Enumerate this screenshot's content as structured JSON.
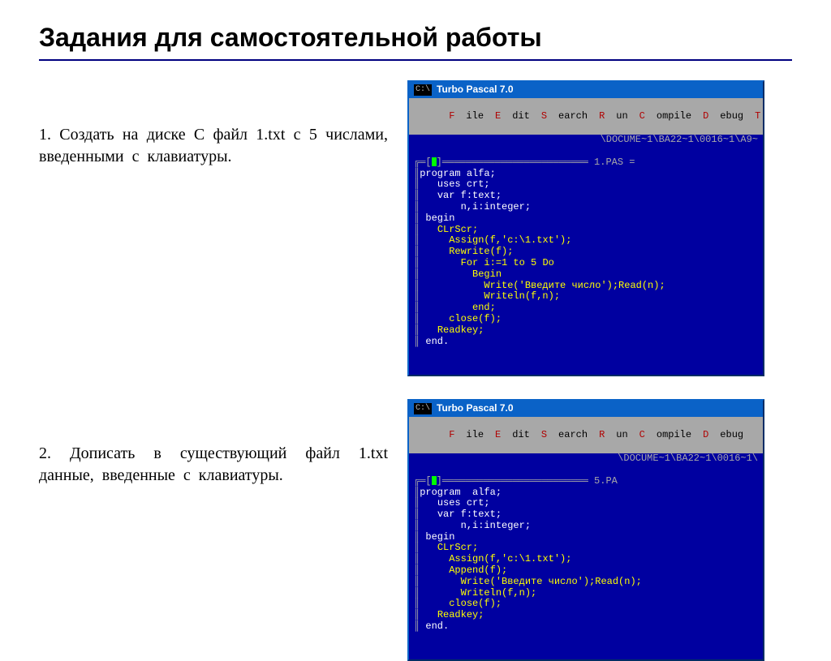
{
  "slide": {
    "title": "Задания для самостоятельной работы",
    "task1": "1. Создать на  диске  С  файл  1.txt  с  5 числами,  введенными с клавиатуры.",
    "task2": "2. Дописать  в  существующий  файл  1.txt данные,  введенные с клавиатуры."
  },
  "tp": {
    "appTitle": "Turbo Pascal 7.0",
    "sys": "C:\\",
    "menu": {
      "file": "File",
      "fileH": "F",
      "edit": "Edit",
      "editH": "E",
      "search": "Search",
      "searchH": "S",
      "run": "Run",
      "runH": "R",
      "compile": "Compile",
      "compileH": "C",
      "debug": "Debug",
      "debugH": "D",
      "trail": "T"
    }
  },
  "win1": {
    "path": "\\DOCUME~1\\BA22~1\\0016~1\\A9~",
    "file": "1.PAS =",
    "code": [
      {
        "pre": "",
        "t": "program alfa;",
        "cls": "wh"
      },
      {
        "pre": "   ",
        "t": "uses crt;",
        "cls": "wh"
      },
      {
        "pre": "   ",
        "t": "var f:text;",
        "cls": "wh"
      },
      {
        "pre": "       ",
        "t": "n,i:integer;",
        "cls": "wh"
      },
      {
        "pre": " ",
        "t": "begin",
        "cls": "wh"
      },
      {
        "pre": "   ",
        "t": "CLrScr;",
        "cls": "ye"
      },
      {
        "pre": "     ",
        "t": "Assign(f,'c:\\1.txt');",
        "cls": "ye"
      },
      {
        "pre": "     ",
        "t": "Rewrite(f);",
        "cls": "ye"
      },
      {
        "pre": "       ",
        "t": "For i:=1 to 5 Do",
        "cls": "ye"
      },
      {
        "pre": "         ",
        "t": "Begin",
        "cls": "ye"
      },
      {
        "pre": "           ",
        "t": "Write('Введите число');Read(n);",
        "cls": "ye"
      },
      {
        "pre": "           ",
        "t": "Writeln(f,n);",
        "cls": "ye"
      },
      {
        "pre": "         ",
        "t": "end;",
        "cls": "ye"
      },
      {
        "pre": "     ",
        "t": "close(f);",
        "cls": "ye"
      },
      {
        "pre": "   ",
        "t": "Readkey;",
        "cls": "ye"
      },
      {
        "pre": " ",
        "t": "end.",
        "cls": "wh"
      }
    ]
  },
  "win2": {
    "path": "\\DOCUME~1\\BA22~1\\0016~1\\",
    "file": "5.PA",
    "code": [
      {
        "pre": "",
        "t": "program  alfa;",
        "cls": "wh"
      },
      {
        "pre": "   ",
        "t": "uses crt;",
        "cls": "wh"
      },
      {
        "pre": "   ",
        "t": "var f:text;",
        "cls": "wh"
      },
      {
        "pre": "       ",
        "t": "n,i:integer;",
        "cls": "wh"
      },
      {
        "pre": " ",
        "t": "begin",
        "cls": "wh"
      },
      {
        "pre": "   ",
        "t": "CLrScr;",
        "cls": "ye"
      },
      {
        "pre": "     ",
        "t": "Assign(f,'c:\\1.txt');",
        "cls": "ye"
      },
      {
        "pre": "     ",
        "t": "Append(f);",
        "cls": "ye"
      },
      {
        "pre": "       ",
        "t": "Write('Введите число');Read(n);",
        "cls": "ye"
      },
      {
        "pre": "       ",
        "t": "Writeln(f,n);",
        "cls": "ye"
      },
      {
        "pre": "     ",
        "t": "close(f);",
        "cls": "ye"
      },
      {
        "pre": "   ",
        "t": "Readkey;",
        "cls": "ye"
      },
      {
        "pre": " ",
        "t": "end.",
        "cls": "wh"
      }
    ]
  }
}
